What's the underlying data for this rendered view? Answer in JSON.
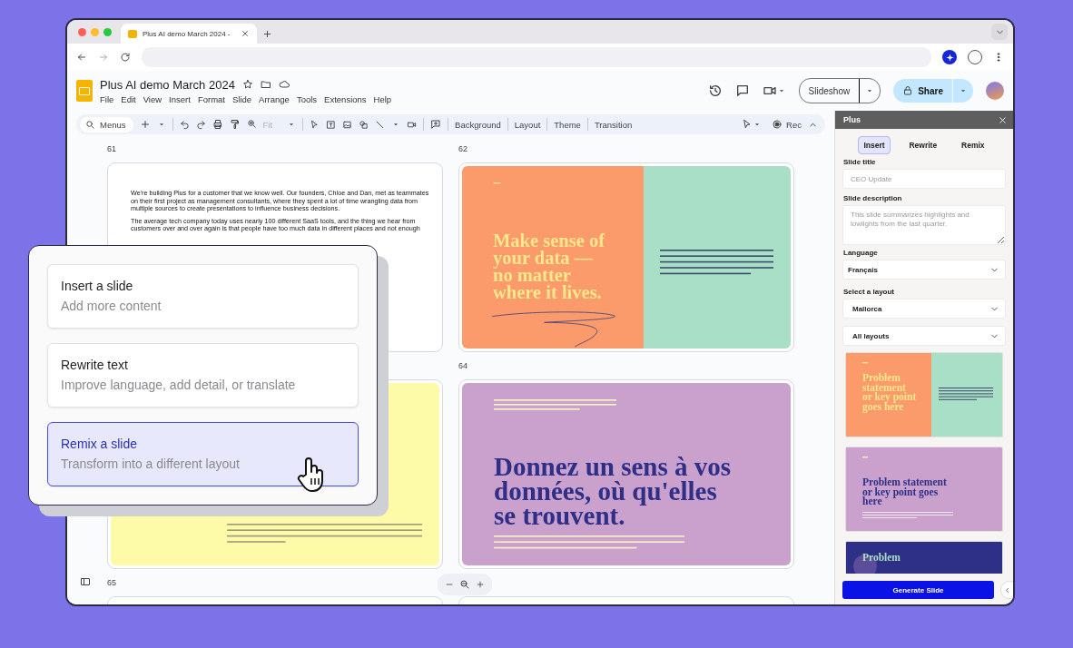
{
  "browser": {
    "tab_title": "Plus AI demo March 2024 -"
  },
  "doc": {
    "title": "Plus AI demo March 2024",
    "menus": [
      "File",
      "Edit",
      "View",
      "Insert",
      "Format",
      "Slide",
      "Arrange",
      "Tools",
      "Extensions",
      "Help"
    ],
    "slideshow": "Slideshow",
    "share": "Share"
  },
  "toolbar": {
    "search_placeholder": "Menus",
    "zoom": "Fit",
    "actions": [
      "Background",
      "Layout",
      "Theme",
      "Transition"
    ],
    "rec": "Rec"
  },
  "slides": [
    {
      "number": "61",
      "kind": "text",
      "paragraphs": [
        "We're building Plus for a customer that we know well. Our founders, Chloe and Dan, met as teammates on their first project as management consultants, where they spent a lot of time wrangling data from multiple sources to create presentations to influence business decisions.",
        "The average tech company today uses nearly 100 different SaaS tools, and the thing we hear from customers over and over again is that people have too much data in different places and not enough"
      ]
    },
    {
      "number": "62",
      "kind": "split",
      "title": "Make sense of\nyour data —\nno matter\nwhere it lives."
    },
    {
      "kind": "yellow"
    },
    {
      "number": "64",
      "kind": "purple",
      "title": "Donnez un sens à vos\ndonnées, où qu'elles\nse trouvent."
    },
    {
      "number": "65",
      "kind": "blank"
    },
    {
      "kind": "blank"
    }
  ],
  "popup": {
    "options": [
      {
        "title": "Insert a slide",
        "subtitle": "Add more content",
        "selected": false
      },
      {
        "title": "Rewrite text",
        "subtitle": "Improve language, add detail, or translate",
        "selected": false
      },
      {
        "title": "Remix a slide",
        "subtitle": "Transform into a different layout",
        "selected": true
      }
    ]
  },
  "panel": {
    "title": "Plus",
    "tabs": [
      {
        "label": "Insert",
        "selected": true
      },
      {
        "label": "Rewrite",
        "selected": false
      },
      {
        "label": "Remix",
        "selected": false
      }
    ],
    "slide_title": {
      "label": "Slide title",
      "placeholder": "CEO Update"
    },
    "slide_description": {
      "label": "Slide description",
      "placeholder": "This slide summarizes highlights and lowlights from the last quarter."
    },
    "language": {
      "label": "Language",
      "value": "Français"
    },
    "layout": {
      "label": "Select a layout",
      "value": "Mallorca"
    },
    "layout_filter": {
      "value": "All layouts"
    },
    "layouts": [
      {
        "kind": "split",
        "title": "Problem\nstatement\nor key point\ngoes here"
      },
      {
        "kind": "purple",
        "title": "Problem statement\nor key point goes\nhere"
      },
      {
        "kind": "navy",
        "title": "Problem"
      }
    ],
    "generate": "Generate Slide"
  }
}
